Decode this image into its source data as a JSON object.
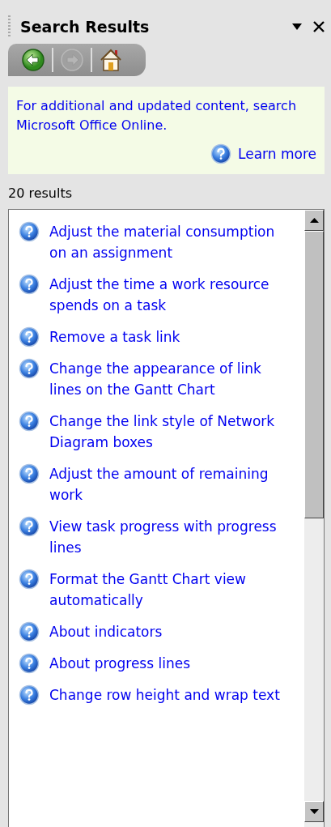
{
  "pane": {
    "title": "Search Results"
  },
  "toolbar": [
    {
      "kind": "back",
      "disabled": false
    },
    {
      "kind": "forward",
      "disabled": true
    },
    {
      "kind": "home",
      "disabled": false
    }
  ],
  "notice": {
    "text": "For additional and updated content, search Microsoft Office Online.",
    "link": "Learn more"
  },
  "result_count": "20 results",
  "results": [
    {
      "text": "Adjust the material consumption on an assignment"
    },
    {
      "text": "Adjust the time a work resource spends on a task"
    },
    {
      "text": "Remove a task link"
    },
    {
      "text": "Change the appearance of link lines on the Gantt Chart"
    },
    {
      "text": "Change the link style of Network Diagram boxes"
    },
    {
      "text": "Adjust the amount of remaining work"
    },
    {
      "text": "View task progress with progress lines"
    },
    {
      "text": "Format the Gantt Chart view automatically"
    },
    {
      "text": "About indicators"
    },
    {
      "text": "About progress lines"
    },
    {
      "text": "Change row height and wrap text"
    }
  ]
}
